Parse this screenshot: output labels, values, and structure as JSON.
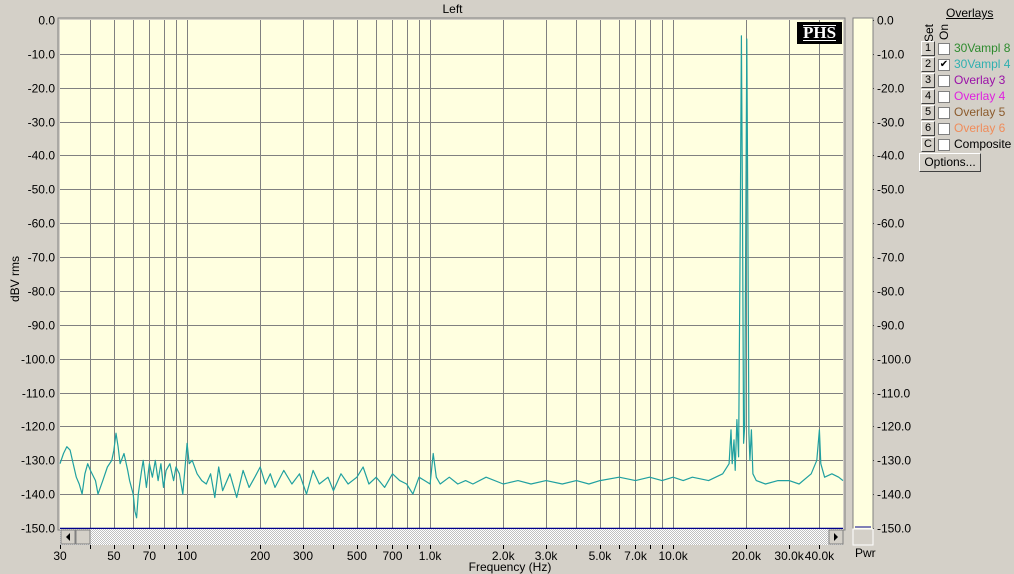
{
  "chart_data": {
    "type": "line",
    "title": "Left",
    "xlabel": "Frequency (Hz)",
    "ylabel": "dBV rms",
    "xscale": "log",
    "xlim": [
      30,
      50000
    ],
    "ylim": [
      -150,
      0
    ],
    "grid": true,
    "x_ticks": [
      30,
      40,
      50,
      60,
      70,
      80,
      90,
      100,
      200,
      300,
      400,
      500,
      600,
      700,
      800,
      900,
      1000,
      2000,
      3000,
      4000,
      5000,
      6000,
      7000,
      8000,
      9000,
      10000,
      20000,
      30000,
      40000
    ],
    "x_tick_labels": [
      {
        "value": 30,
        "label": "30"
      },
      {
        "value": 50,
        "label": "50"
      },
      {
        "value": 70,
        "label": "70"
      },
      {
        "value": 100,
        "label": "100"
      },
      {
        "value": 200,
        "label": "200"
      },
      {
        "value": 300,
        "label": "300"
      },
      {
        "value": 500,
        "label": "500"
      },
      {
        "value": 700,
        "label": "700"
      },
      {
        "value": 1000,
        "label": "1.0k"
      },
      {
        "value": 2000,
        "label": "2.0k"
      },
      {
        "value": 3000,
        "label": "3.0k"
      },
      {
        "value": 5000,
        "label": "5.0k"
      },
      {
        "value": 7000,
        "label": "7.0k"
      },
      {
        "value": 10000,
        "label": "10.0k"
      },
      {
        "value": 20000,
        "label": "20.0k"
      },
      {
        "value": 30000,
        "label": "30.0k"
      },
      {
        "value": 40000,
        "label": "40.0k"
      }
    ],
    "y_ticks": [
      "0.0",
      "-10.0",
      "-20.0",
      "-30.0",
      "-40.0",
      "-50.0",
      "-60.0",
      "-70.0",
      "-80.0",
      "-90.0",
      "-100.0",
      "-110.0",
      "-120.0",
      "-130.0",
      "-140.0",
      "-150.0"
    ],
    "series": [
      {
        "name": "30Vampl 4",
        "color": "#20a0a0",
        "points": [
          [
            30,
            -131
          ],
          [
            31,
            -128
          ],
          [
            32,
            -126
          ],
          [
            33,
            -127
          ],
          [
            34,
            -131
          ],
          [
            35,
            -135
          ],
          [
            36,
            -137
          ],
          [
            37,
            -140
          ],
          [
            38,
            -134
          ],
          [
            39,
            -131
          ],
          [
            40,
            -133
          ],
          [
            42,
            -136
          ],
          [
            43,
            -140
          ],
          [
            45,
            -136
          ],
          [
            47,
            -132
          ],
          [
            49,
            -130
          ],
          [
            50,
            -127
          ],
          [
            51,
            -122
          ],
          [
            52,
            -126
          ],
          [
            53,
            -131
          ],
          [
            55,
            -128
          ],
          [
            57,
            -133
          ],
          [
            58,
            -136
          ],
          [
            60,
            -140
          ],
          [
            61,
            -145
          ],
          [
            62,
            -147
          ],
          [
            63,
            -140
          ],
          [
            65,
            -133
          ],
          [
            66,
            -130
          ],
          [
            68,
            -138
          ],
          [
            70,
            -131
          ],
          [
            72,
            -135
          ],
          [
            74,
            -130
          ],
          [
            76,
            -136
          ],
          [
            78,
            -131
          ],
          [
            80,
            -138
          ],
          [
            82,
            -133
          ],
          [
            85,
            -131
          ],
          [
            88,
            -136
          ],
          [
            90,
            -132
          ],
          [
            93,
            -134
          ],
          [
            96,
            -140
          ],
          [
            100,
            -125
          ],
          [
            102,
            -131
          ],
          [
            105,
            -130
          ],
          [
            110,
            -134
          ],
          [
            115,
            -136
          ],
          [
            120,
            -137
          ],
          [
            125,
            -134
          ],
          [
            130,
            -141
          ],
          [
            135,
            -132
          ],
          [
            140,
            -139
          ],
          [
            150,
            -134
          ],
          [
            160,
            -141
          ],
          [
            170,
            -133
          ],
          [
            180,
            -138
          ],
          [
            190,
            -135
          ],
          [
            200,
            -132
          ],
          [
            210,
            -137
          ],
          [
            220,
            -134
          ],
          [
            230,
            -138
          ],
          [
            250,
            -133
          ],
          [
            270,
            -137
          ],
          [
            290,
            -134
          ],
          [
            310,
            -140
          ],
          [
            330,
            -133
          ],
          [
            350,
            -137
          ],
          [
            380,
            -135
          ],
          [
            400,
            -139
          ],
          [
            430,
            -134
          ],
          [
            460,
            -137
          ],
          [
            500,
            -135
          ],
          [
            530,
            -132
          ],
          [
            560,
            -137
          ],
          [
            600,
            -135
          ],
          [
            650,
            -138
          ],
          [
            700,
            -134
          ],
          [
            750,
            -136
          ],
          [
            800,
            -137
          ],
          [
            850,
            -140
          ],
          [
            900,
            -135
          ],
          [
            950,
            -136
          ],
          [
            1000,
            -137
          ],
          [
            1030,
            -128
          ],
          [
            1060,
            -135
          ],
          [
            1100,
            -137
          ],
          [
            1200,
            -135
          ],
          [
            1300,
            -137
          ],
          [
            1400,
            -136
          ],
          [
            1500,
            -137
          ],
          [
            1700,
            -135
          ],
          [
            2000,
            -137
          ],
          [
            2300,
            -136
          ],
          [
            2600,
            -137
          ],
          [
            3000,
            -136
          ],
          [
            3500,
            -137
          ],
          [
            4000,
            -136
          ],
          [
            4500,
            -137
          ],
          [
            5000,
            -136
          ],
          [
            6000,
            -135
          ],
          [
            7000,
            -136
          ],
          [
            8000,
            -135
          ],
          [
            9000,
            -136
          ],
          [
            10000,
            -135
          ],
          [
            11000,
            -136
          ],
          [
            12000,
            -135
          ],
          [
            14000,
            -136
          ],
          [
            16000,
            -134
          ],
          [
            17000,
            -131
          ],
          [
            17300,
            -121
          ],
          [
            17500,
            -131
          ],
          [
            17800,
            -124
          ],
          [
            18000,
            -133
          ],
          [
            18300,
            -118
          ],
          [
            18600,
            -129
          ],
          [
            18900,
            -59
          ],
          [
            19100,
            -4.7
          ],
          [
            19300,
            -57
          ],
          [
            19500,
            -125
          ],
          [
            19700,
            -120
          ],
          [
            19900,
            -60
          ],
          [
            20100,
            -5.6
          ],
          [
            20300,
            -62
          ],
          [
            20500,
            -122
          ],
          [
            20700,
            -130
          ],
          [
            21000,
            -121
          ],
          [
            21300,
            -134
          ],
          [
            22000,
            -136
          ],
          [
            24000,
            -137
          ],
          [
            27000,
            -136
          ],
          [
            30000,
            -136
          ],
          [
            33000,
            -137
          ],
          [
            37000,
            -134
          ],
          [
            39000,
            -130
          ],
          [
            40000,
            -121
          ],
          [
            40500,
            -131
          ],
          [
            42000,
            -135
          ],
          [
            45000,
            -134
          ],
          [
            48000,
            -135
          ],
          [
            50000,
            -136
          ]
        ]
      }
    ]
  },
  "logo": "PHS",
  "power_meter": {
    "label": "Pwr",
    "value_db": -150
  },
  "overlays": {
    "title": "Overlays",
    "set_header": "Set",
    "on_header": "On",
    "items": [
      {
        "set": "1",
        "label": "30Vampl 8",
        "checked": false,
        "color": "#2e8b2e"
      },
      {
        "set": "2",
        "label": "30Vampl 4",
        "checked": true,
        "color": "#30b0b0"
      },
      {
        "set": "3",
        "label": "Overlay 3",
        "checked": false,
        "color": "#9a10a8"
      },
      {
        "set": "4",
        "label": "Overlay 4",
        "checked": false,
        "color": "#e020e0"
      },
      {
        "set": "5",
        "label": "Overlay 5",
        "checked": false,
        "color": "#8b5a2b"
      },
      {
        "set": "6",
        "label": "Overlay 6",
        "checked": false,
        "color": "#f08c5a"
      },
      {
        "set": "C",
        "label": "Composite",
        "checked": false,
        "color": "#000000"
      }
    ],
    "options_label": "Options...",
    "check_mark": "✔"
  }
}
